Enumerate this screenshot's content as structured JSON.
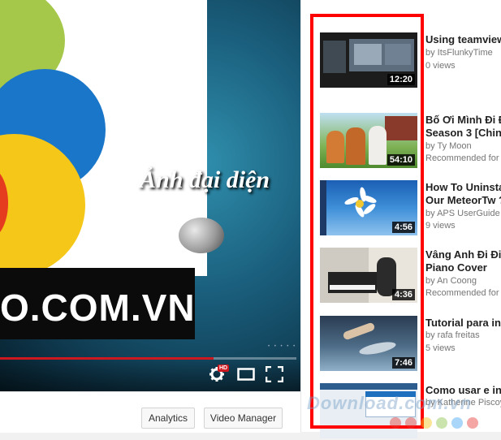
{
  "player": {
    "overlay_text": "Ảnh đại diện",
    "brand_text": "O.COM.VN",
    "hd_badge": "HD",
    "progress_fraction": 0.72,
    "controls": [
      "settings-icon",
      "theater-mode-icon",
      "fullscreen-icon"
    ]
  },
  "actions": {
    "analytics_label": "Analytics",
    "video_manager_label": "Video Manager"
  },
  "sidebar": {
    "items": [
      {
        "title_lines": [
          "Using teamviewer"
        ],
        "channel": "by ItsFlunkyTime",
        "stat": "0 views",
        "duration": "12:20"
      },
      {
        "title_lines": [
          "Bố Ơi Mình Đi Đâ",
          "Season 3 [China]"
        ],
        "channel": "by Ty Moon",
        "stat": "Recommended for y",
        "duration": "54:10"
      },
      {
        "title_lines": [
          "How To Uninstal",
          "Our MeteorTw ?"
        ],
        "channel": "by APS UserGuide",
        "stat": "9 views",
        "duration": "4:56"
      },
      {
        "title_lines": [
          "Vâng Anh Đi Đi -",
          "Piano Cover"
        ],
        "channel": "by An Coong",
        "stat": "Recommended for y",
        "duration": "4:36"
      },
      {
        "title_lines": [
          "Tutorial para inst"
        ],
        "channel": "by rafa freitas",
        "stat": "5 views",
        "duration": "7:46"
      },
      {
        "title_lines": [
          "Como usar e insti"
        ],
        "channel": "by Katherine Piscoy",
        "stat": "",
        "duration": ""
      }
    ]
  },
  "watermark": {
    "text": "Download.com.vn",
    "dot_colors": [
      "#e53935",
      "#e53935",
      "#f5c518",
      "#8bc34a",
      "#42a5f5",
      "#e53935"
    ]
  },
  "colors": {
    "highlight": "#ff0000",
    "progress": "#cc181e"
  }
}
